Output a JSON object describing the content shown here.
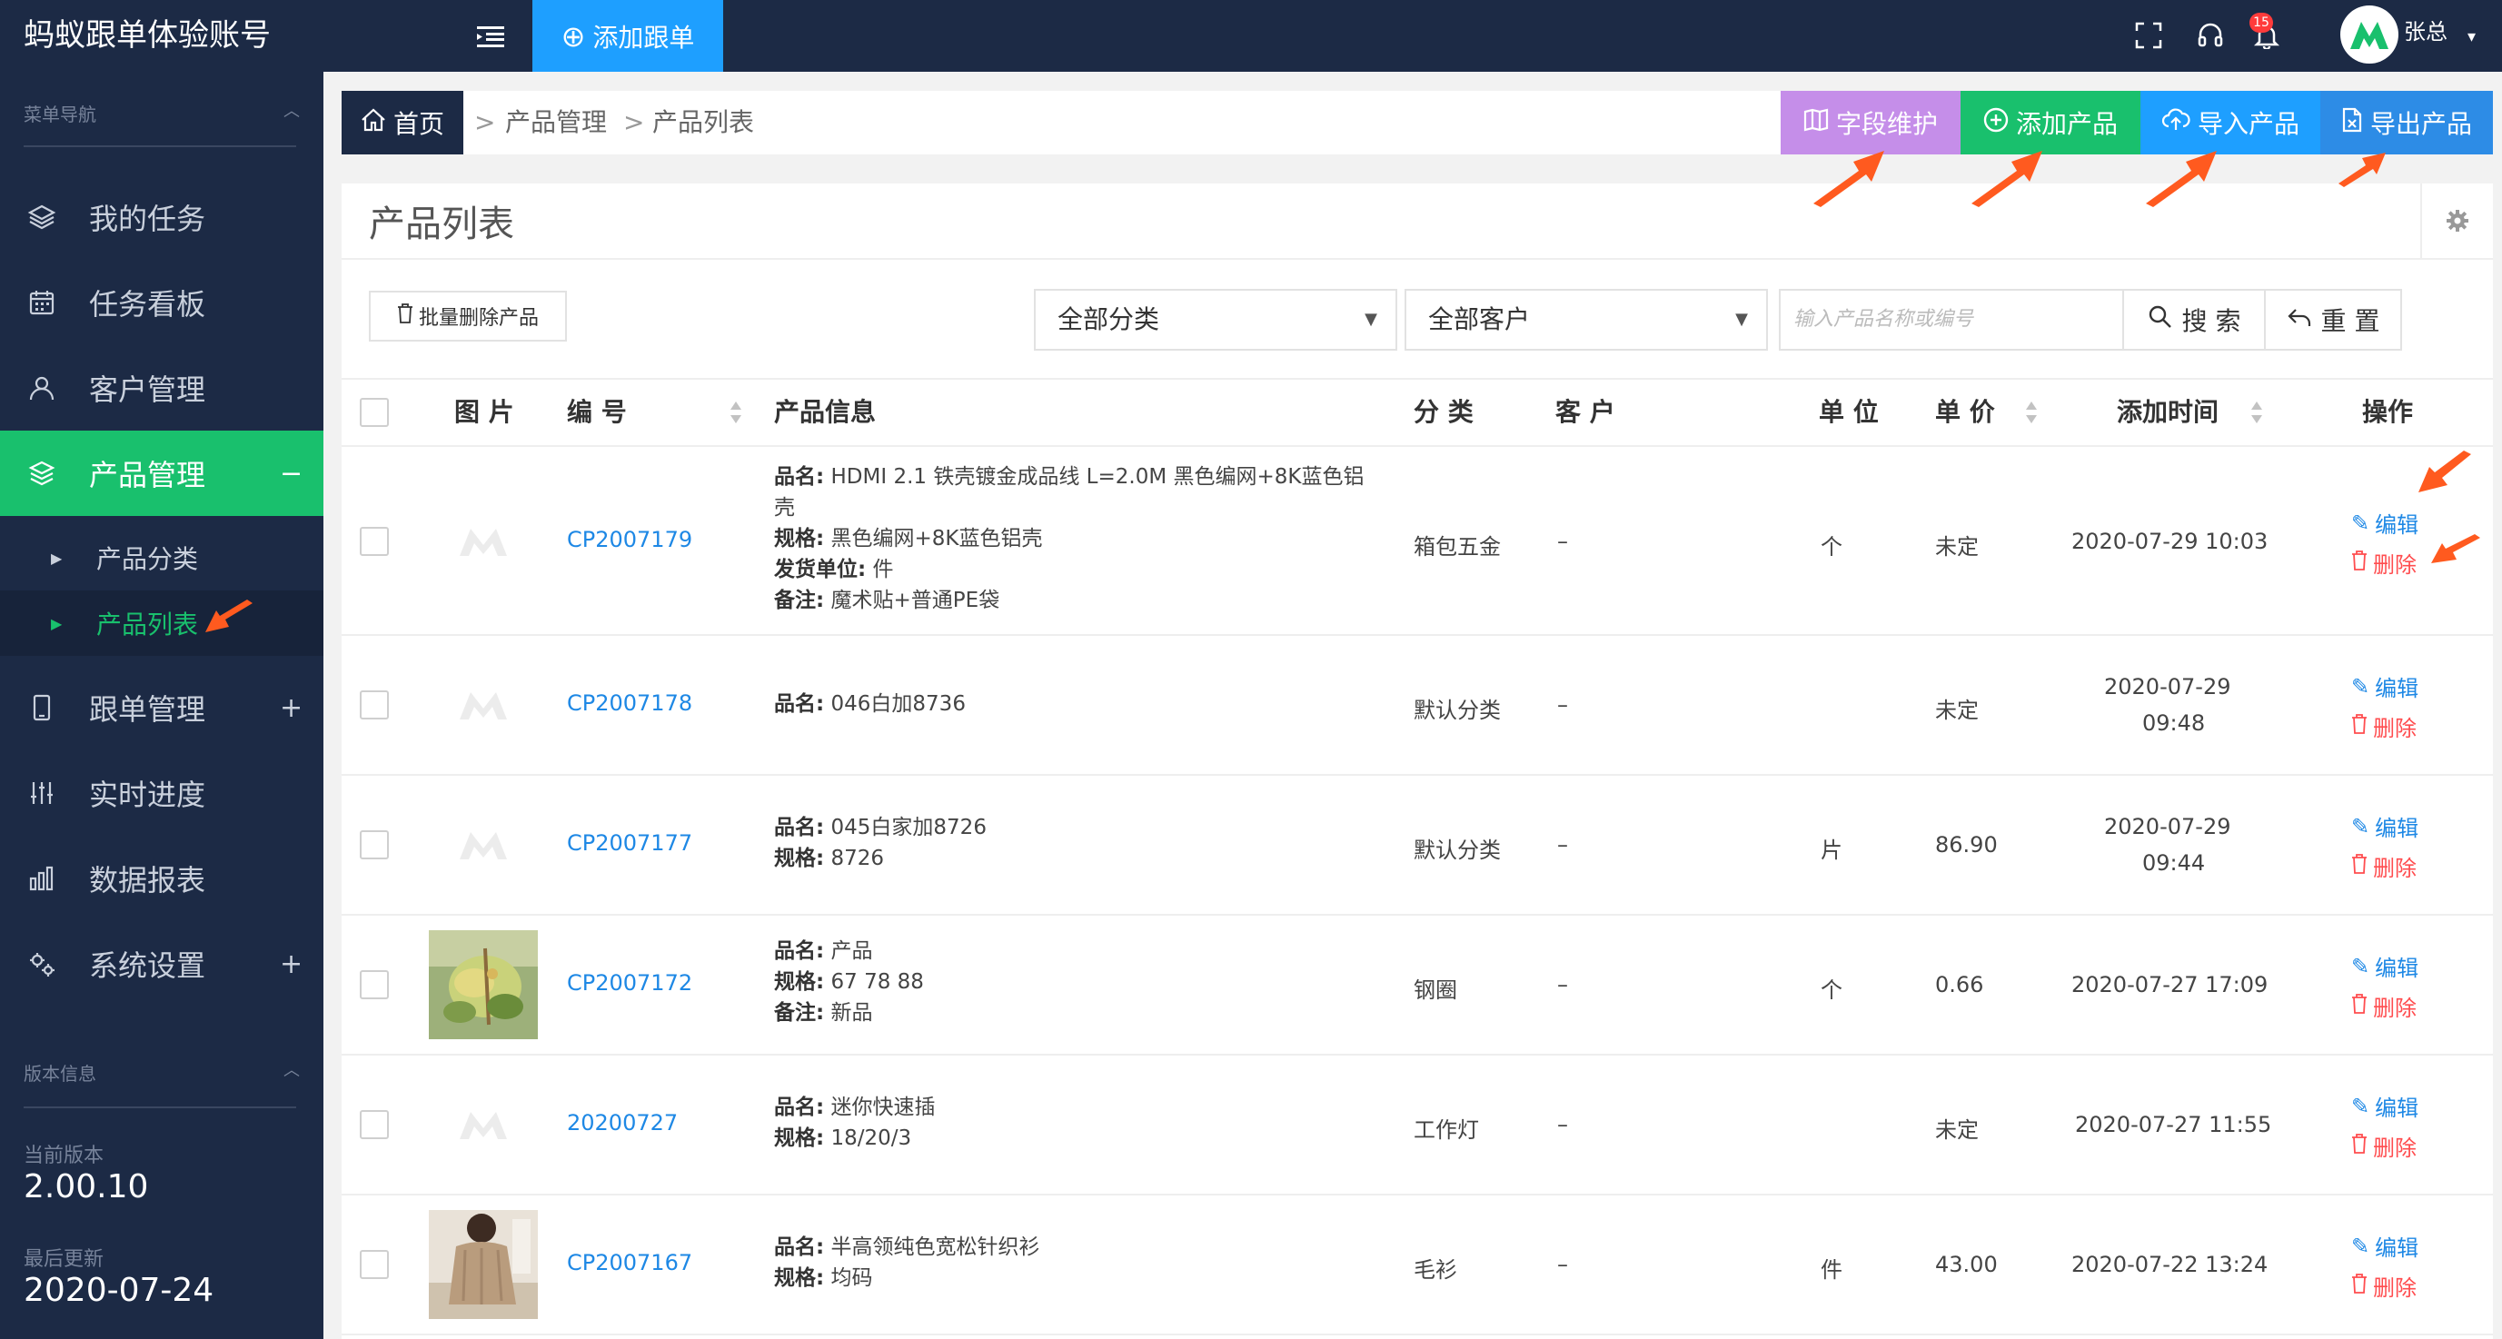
{
  "app": {
    "title": "蚂蚁跟单体验账号"
  },
  "topbar": {
    "add_order_label": "添加跟单",
    "notification_count": "15",
    "user_name": "张总"
  },
  "sidebar": {
    "section_label": "菜单导航",
    "items": [
      {
        "label": "我的任务",
        "icon": "layers-icon"
      },
      {
        "label": "任务看板",
        "icon": "calendar-icon"
      },
      {
        "label": "客户管理",
        "icon": "user-icon"
      },
      {
        "label": "产品管理",
        "icon": "box-icon",
        "expand": "−"
      },
      {
        "label": "跟单管理",
        "icon": "mobile-icon",
        "expand": "+"
      },
      {
        "label": "实时进度",
        "icon": "sliders-icon"
      },
      {
        "label": "数据报表",
        "icon": "bar-chart-icon"
      },
      {
        "label": "系统设置",
        "icon": "gears-icon",
        "expand": "+"
      }
    ],
    "sub_items": [
      {
        "label": "产品分类"
      },
      {
        "label": "产品列表"
      }
    ],
    "version_section_label": "版本信息",
    "current_version_label": "当前版本",
    "current_version": "2.00.10",
    "last_update_label": "最后更新",
    "last_update": "2020-07-24"
  },
  "breadcrumb": {
    "home": "首页",
    "level1": "产品管理",
    "level2": "产品列表",
    "separator": ">"
  },
  "actions": {
    "field_maintenance": "字段维护",
    "add_product": "添加产品",
    "import_product": "导入产品",
    "export_product": "导出产品",
    "colors": {
      "field": "#c58ee9",
      "add": "#19c06d",
      "import": "#1e9fff",
      "export": "#2d8ce6"
    }
  },
  "panel": {
    "title": "产品列表",
    "bulk_delete_label": "批量删除产品",
    "category_select": "全部分类",
    "customer_select": "全部客户",
    "search_placeholder": "输入产品名称或编号",
    "search_label": "搜 索",
    "reset_label": "重 置"
  },
  "table": {
    "headers": {
      "image": "图 片",
      "code": "编 号",
      "info": "产品信息",
      "category": "分 类",
      "customer": "客 户",
      "unit": "单 位",
      "price": "单 价",
      "added": "添加时间",
      "ops": "操作"
    },
    "edit_label": "编辑",
    "delete_label": "删除",
    "info_labels": {
      "name": "品名:",
      "spec": "规格:",
      "ship": "发货单位:",
      "note": "备注:"
    },
    "rows": [
      {
        "code": "CP2007179",
        "name": "HDMI 2.1 铁壳镀金成品线 L=2.0M 黑色编网+8K蓝色铝",
        "name_cont": "壳",
        "spec": "黑色编网+8K蓝色铝壳",
        "ship": "件",
        "note": "魔术贴+普通PE袋",
        "category": "箱包五金",
        "customer": "–",
        "unit": "个",
        "price": "未定",
        "date": "2020-07-29 10:03"
      },
      {
        "code": "CP2007178",
        "name": "046白加8736",
        "category": "默认分类",
        "customer": "–",
        "unit": "",
        "price": "未定",
        "date_line1": "2020-07-29",
        "date_line2": "09:48"
      },
      {
        "code": "CP2007177",
        "name": "045白家加8726",
        "spec": "8726",
        "category": "默认分类",
        "customer": "–",
        "unit": "片",
        "price": "86.90",
        "date_line1": "2020-07-29",
        "date_line2": "09:44"
      },
      {
        "code": "CP2007172",
        "name": "产品",
        "spec": "67 78 88",
        "note": "新品",
        "category": "钢圈",
        "customer": "–",
        "unit": "个",
        "price": "0.66",
        "date": "2020-07-27 17:09"
      },
      {
        "code": "20200727",
        "name": "迷你快速插",
        "spec": "18/20/3",
        "category": "工作灯",
        "customer": "–",
        "unit": "",
        "price": "未定",
        "date": "2020-07-27 11:55"
      },
      {
        "code": "CP2007167",
        "name": "半高领纯色宽松针织衫",
        "spec": "均码",
        "category": "毛衫",
        "customer": "–",
        "unit": "件",
        "price": "43.00",
        "date": "2020-07-22 13:24"
      }
    ]
  }
}
